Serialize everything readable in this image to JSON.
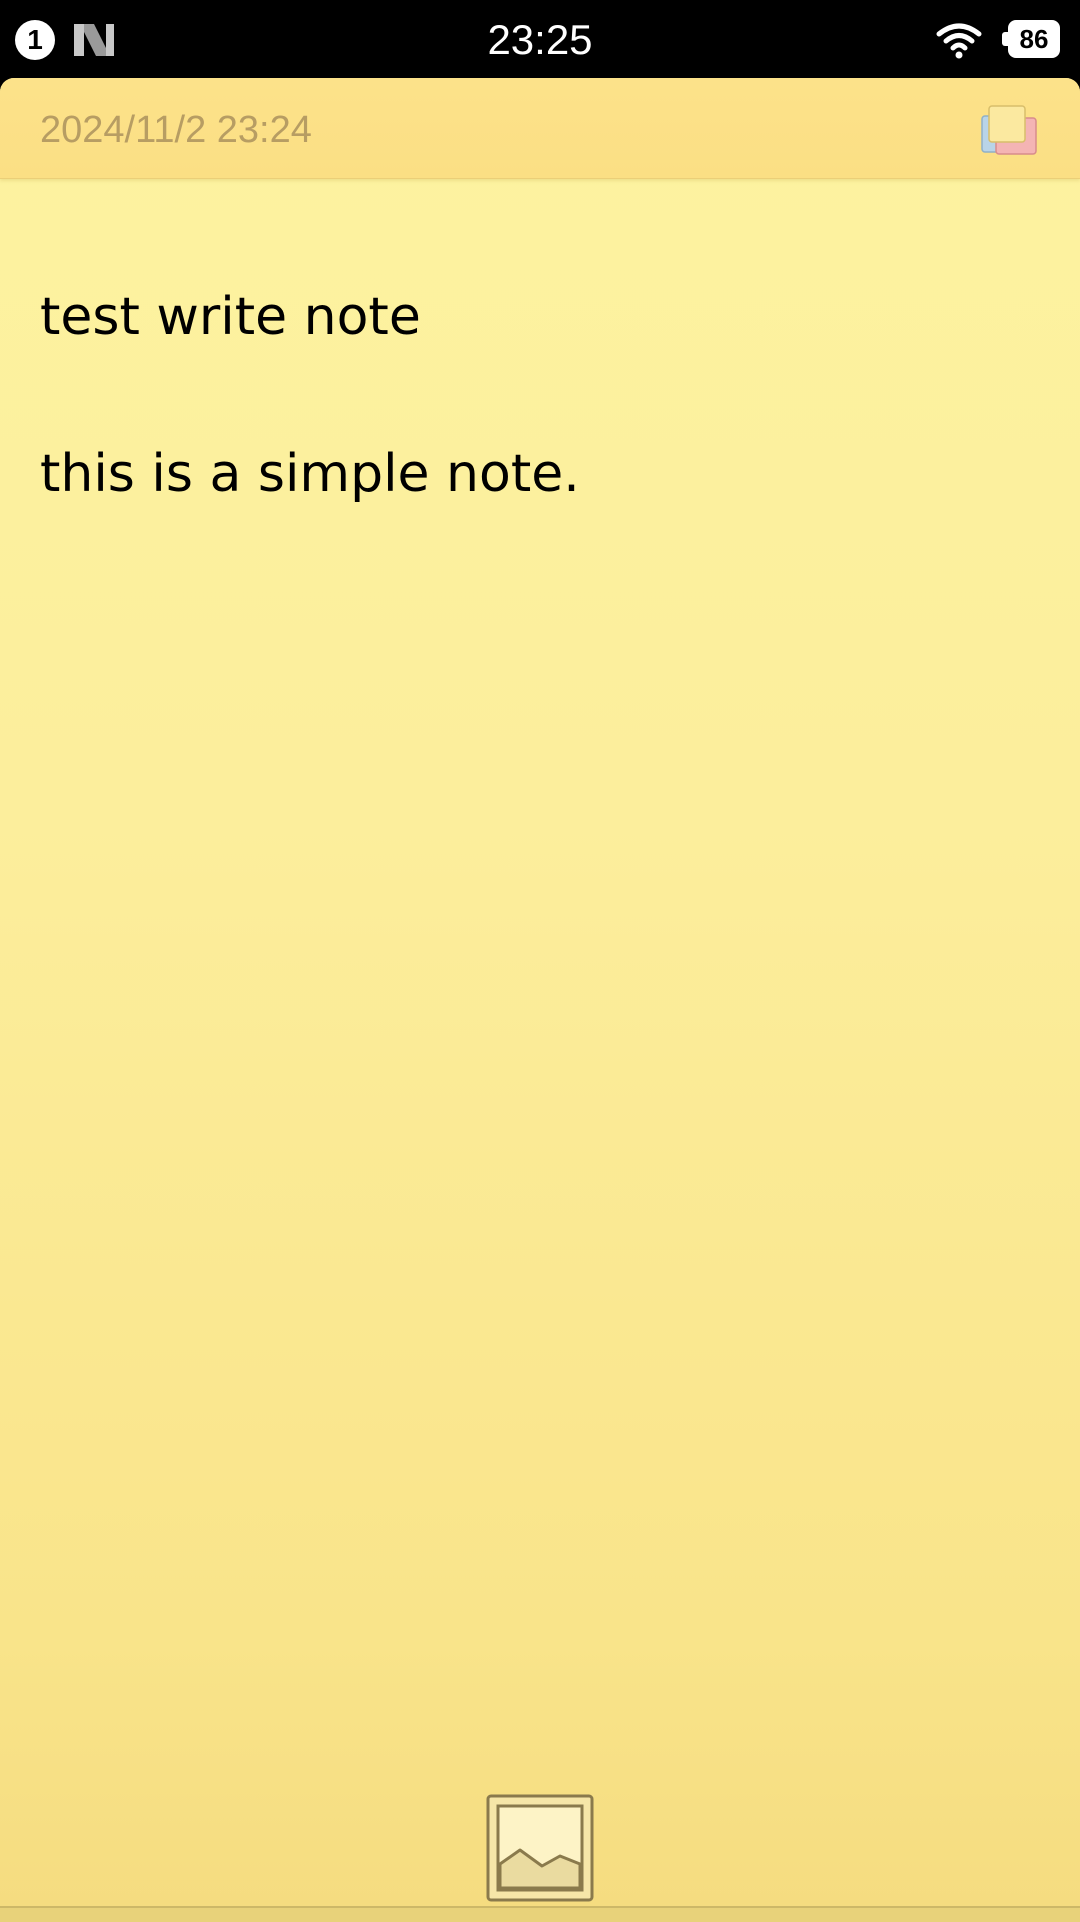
{
  "status_bar": {
    "notification_count": "1",
    "notification_app_icon": "n-logo-icon",
    "time": "23:25",
    "wifi_icon": "wifi-icon",
    "battery_level": "86"
  },
  "note": {
    "date": "2024/11/2 23:24",
    "copy_icon": "copy-notes-icon",
    "lines": [
      "test write note",
      "",
      "this is a simple note."
    ],
    "image_icon": "image-icon",
    "colors": {
      "paper": "#fcee9c",
      "header": "#fbdf84",
      "date_text": "#b79d63",
      "body_text": "#000000"
    }
  }
}
